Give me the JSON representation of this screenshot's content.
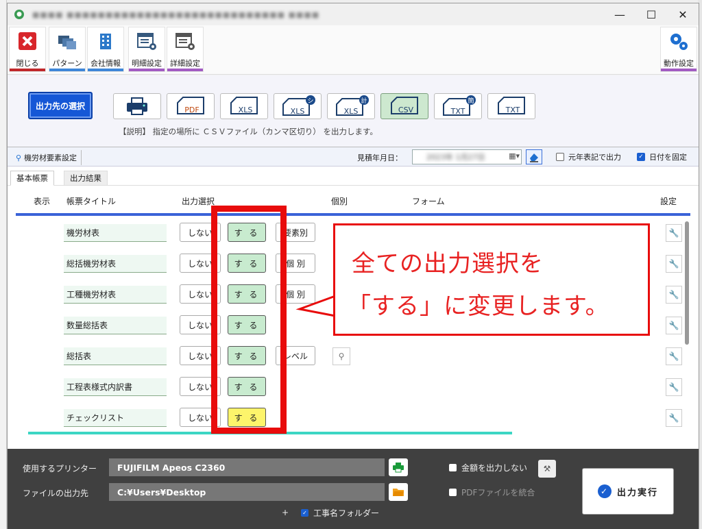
{
  "window": {
    "title": "■■■■ ■■■■■■■■■■■■■■■■■■■■■■■■■■■■ ■■■■"
  },
  "toolbar": {
    "close": "閉じる",
    "pattern": "パターン",
    "company": "会社情報",
    "detail_settings": "明細設定",
    "detailed_settings": "詳細設定",
    "behavior_settings": "動作設定"
  },
  "output": {
    "select_destination": "出力先の選択",
    "formats": [
      "PDF",
      "XLS",
      "XLS",
      "XLS",
      "CSV",
      "TXT",
      "TXT"
    ],
    "format_badges": [
      "",
      "",
      "シ",
      "計",
      "",
      "簡",
      ""
    ],
    "active_format": "CSV",
    "description": "【説明】 指定の場所に ＣＳＶファイル（カンマ区切り） を出力します。"
  },
  "grid": {
    "settings_tab": "機労材要素設定",
    "date_label": "見積年月日：",
    "date_value": "2023年 1月27日",
    "gengo_label": "元年表記で出力",
    "fix_date_label": "日付を固定",
    "tabs": [
      "基本帳票",
      "出力結果"
    ],
    "columns": {
      "show": "表示",
      "title": "帳票タイトル",
      "output_select": "出力選択",
      "individual": "個別",
      "form": "フォーム",
      "settings": "設定"
    },
    "rows": [
      {
        "title": "機労材表",
        "no": "しない",
        "yes": "す る",
        "ind": "要素別"
      },
      {
        "title": "総括機労材表",
        "no": "しない",
        "yes": "す る",
        "ind": "個 別"
      },
      {
        "title": "工種機労材表",
        "no": "しない",
        "yes": "す る",
        "ind": "個 別"
      },
      {
        "title": "数量総括表",
        "no": "しない",
        "yes": "す る",
        "ind": ""
      },
      {
        "title": "総括表",
        "no": "しない",
        "yes": "す る",
        "ind": "レベル"
      },
      {
        "title": "工程表様式内訳書",
        "no": "しない",
        "yes": "す る",
        "ind": ""
      },
      {
        "title": "チェックリスト",
        "no": "しない",
        "yes": "す る",
        "ind": ""
      }
    ]
  },
  "callout": {
    "line1": "全ての出力選択を",
    "line2": "「する」に変更します。"
  },
  "bottom": {
    "printer_label": "使用するプリンター",
    "printer_value": "FUJIFILM Apeos C2360",
    "dest_label": "ファイルの出力先",
    "dest_value": "C:¥Users¥Desktop",
    "no_amount_label": "金額を出力しない",
    "merge_pdf_label": "PDFファイルを統合",
    "folder_label": "工事名フォルダー",
    "plus": "+",
    "execute": "出力実行"
  },
  "colors": {
    "accent_blue": "#1557d6",
    "csv_active": "#cde8cf",
    "yes_green": "#c8ebcf",
    "yes_yellow": "#fdf46b",
    "annotation_red": "#e80c0c"
  }
}
